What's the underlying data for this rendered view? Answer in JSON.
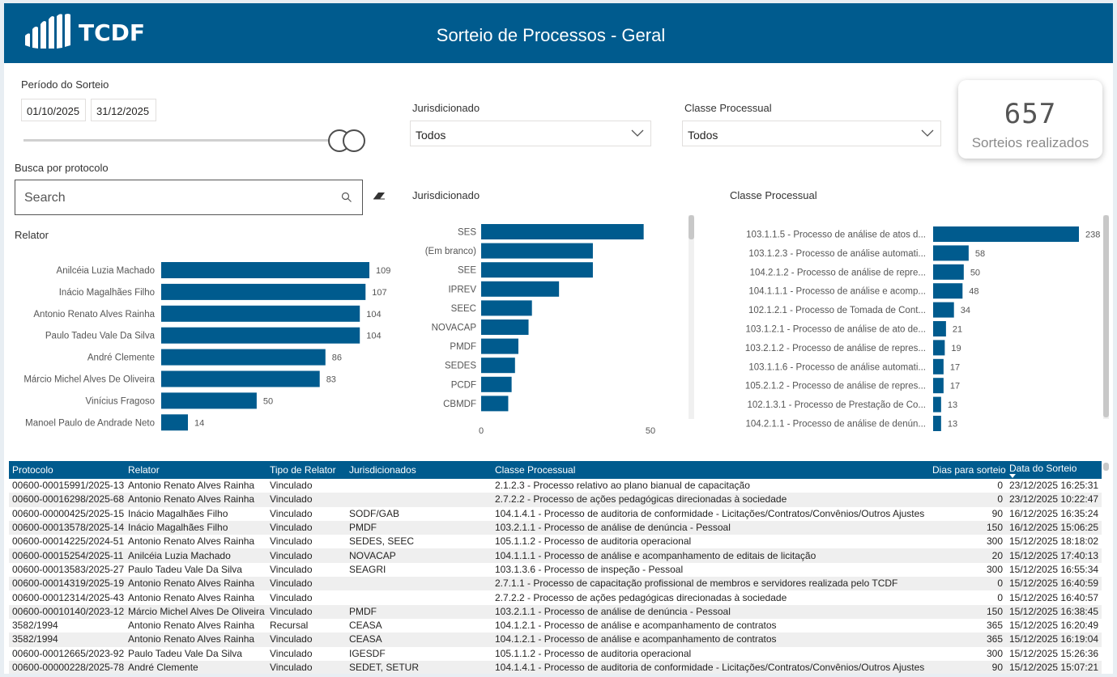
{
  "header": {
    "logo_text": "TCDF",
    "title": "Sorteio de Processos - Geral"
  },
  "filters": {
    "period_label": "Período do Sorteio",
    "date_start": "01/10/2025",
    "date_end": "31/12/2025",
    "jurisdicionado_label": "Jurisdicionado",
    "jurisdicionado_value": "Todos",
    "classe_label": "Classe Processual",
    "classe_value": "Todos"
  },
  "kpi": {
    "value": "657",
    "label": "Sorteios realizados"
  },
  "search": {
    "label": "Busca por protocolo",
    "placeholder": "Search"
  },
  "colors": {
    "header": "#005b8e",
    "bar": "#005b8e"
  },
  "chart_data": [
    {
      "type": "bar",
      "orientation": "horizontal",
      "title": "Relator",
      "categories": [
        "Anilcéia Luzia Machado",
        "Inácio Magalhães Filho",
        "Antonio Renato Alves Rainha",
        "Paulo Tadeu Vale Da Silva",
        "André Clemente",
        "Márcio Michel Alves De Oliveira",
        "Vinícius Fragoso",
        "Manoel Paulo de Andrade Neto"
      ],
      "values": [
        109,
        107,
        104,
        104,
        86,
        83,
        50,
        14
      ],
      "xlim": [
        0,
        109
      ]
    },
    {
      "type": "bar",
      "orientation": "horizontal",
      "title": "Jurisdicionado",
      "categories": [
        "SES",
        "(Em branco)",
        "SEE",
        "IPREV",
        "SEEC",
        "NOVACAP",
        "PMDF",
        "SEDES",
        "PCDF",
        "CBMDF"
      ],
      "values": [
        48,
        33,
        33,
        23,
        15,
        14,
        11,
        10,
        9,
        8
      ],
      "xticks": [
        "0",
        "50"
      ],
      "xlim": [
        0,
        50
      ]
    },
    {
      "type": "bar",
      "orientation": "horizontal",
      "title": "Classe Processual",
      "categories": [
        "103.1.1.5 - Processo de análise de atos d...",
        "103.1.2.3 - Processo de análise automati...",
        "104.2.1.2 - Processo de análise de repre...",
        "104.1.1.1 - Processo de análise e acomp...",
        "102.1.2.1 - Processo de Tomada de Cont...",
        "103.1.2.1 - Processo de análise de ato de...",
        "103.2.1.2 - Processo de análise de repres...",
        "103.1.1.6 - Processo de análise automati...",
        "105.2.1.2 - Processo de análise de repres...",
        "102.1.3.1 - Processo de Prestação de Co...",
        "104.2.1.1 - Processo de análise de denún..."
      ],
      "values": [
        238,
        58,
        50,
        48,
        34,
        21,
        19,
        17,
        17,
        13,
        13
      ],
      "xlim": [
        0,
        238
      ]
    }
  ],
  "table": {
    "columns": [
      "Protocolo",
      "Relator",
      "Tipo de Relator",
      "Jurisdicionados",
      "Classe Processual",
      "Dias para sorteio",
      "Data do Sorteio"
    ],
    "rows": [
      [
        "00600-00015991/2025-13",
        "Antonio Renato Alves Rainha",
        "Vinculado",
        "",
        "2.1.2.3 - Processo relativo ao plano bianual de capacitação",
        "0",
        "23/12/2025 16:25:31"
      ],
      [
        "00600-00016298/2025-68",
        "Antonio Renato Alves Rainha",
        "Vinculado",
        "",
        "2.7.2.2 - Processo de ações pedagógicas direcionadas à sociedade",
        "0",
        "23/12/2025 10:22:47"
      ],
      [
        "00600-00000425/2025-15",
        "Inácio Magalhães Filho",
        "Vinculado",
        "SODF/GAB",
        "104.1.4.1 - Processo de auditoria de conformidade - Licitações/Contratos/Convênios/Outros Ajustes",
        "90",
        "16/12/2025 16:35:24"
      ],
      [
        "00600-00013578/2025-14",
        "Inácio Magalhães Filho",
        "Vinculado",
        "PMDF",
        "103.2.1.1 - Processo de análise de denúncia - Pessoal",
        "150",
        "16/12/2025 15:06:25"
      ],
      [
        "00600-00014225/2024-51",
        "Antonio Renato Alves Rainha",
        "Vinculado",
        "SEDES, SEEC",
        "105.1.1.2 - Processo de auditoria operacional",
        "300",
        "15/12/2025 18:18:02"
      ],
      [
        "00600-00015254/2025-11",
        "Anilcéia Luzia Machado",
        "Vinculado",
        "NOVACAP",
        "104.1.1.1 - Processo de análise e acompanhamento de editais de licitação",
        "20",
        "15/12/2025 17:40:13"
      ],
      [
        "00600-00013583/2025-27",
        "Paulo Tadeu Vale Da Silva",
        "Vinculado",
        "SEAGRI",
        "103.1.3.6 - Processo de inspeção - Pessoal",
        "300",
        "15/12/2025 16:55:34"
      ],
      [
        "00600-00014319/2025-19",
        "Antonio Renato Alves Rainha",
        "Vinculado",
        "",
        "2.7.1.1 - Processo de capacitação profissional de membros e servidores realizada pelo TCDF",
        "0",
        "15/12/2025 16:40:59"
      ],
      [
        "00600-00012314/2025-43",
        "Antonio Renato Alves Rainha",
        "Vinculado",
        "",
        "2.7.2.2 - Processo de ações pedagógicas direcionadas à sociedade",
        "0",
        "15/12/2025 16:40:57"
      ],
      [
        "00600-00010140/2023-12",
        "Márcio Michel Alves De Oliveira",
        "Vinculado",
        "PMDF",
        "103.2.1.1 - Processo de análise de denúncia - Pessoal",
        "150",
        "15/12/2025 16:38:45"
      ],
      [
        "3582/1994",
        "Antonio Renato Alves Rainha",
        "Recursal",
        "CEASA",
        "104.1.2.1 - Processo de análise e acompanhamento de contratos",
        "365",
        "15/12/2025 16:20:49"
      ],
      [
        "3582/1994",
        "Antonio Renato Alves Rainha",
        "Vinculado",
        "CEASA",
        "104.1.2.1 - Processo de análise e acompanhamento de contratos",
        "365",
        "15/12/2025 16:19:04"
      ],
      [
        "00600-00012665/2023-92",
        "Paulo Tadeu Vale Da Silva",
        "Vinculado",
        "IGESDF",
        "105.1.1.2 - Processo de auditoria operacional",
        "300",
        "15/12/2025 15:26:36"
      ],
      [
        "00600-00000228/2025-78",
        "André Clemente",
        "Vinculado",
        "SEDET, SETUR",
        "104.1.4.1 - Processo de auditoria de conformidade - Licitações/Contratos/Convênios/Outros Ajustes",
        "90",
        "15/12/2025 15:07:21"
      ]
    ]
  }
}
